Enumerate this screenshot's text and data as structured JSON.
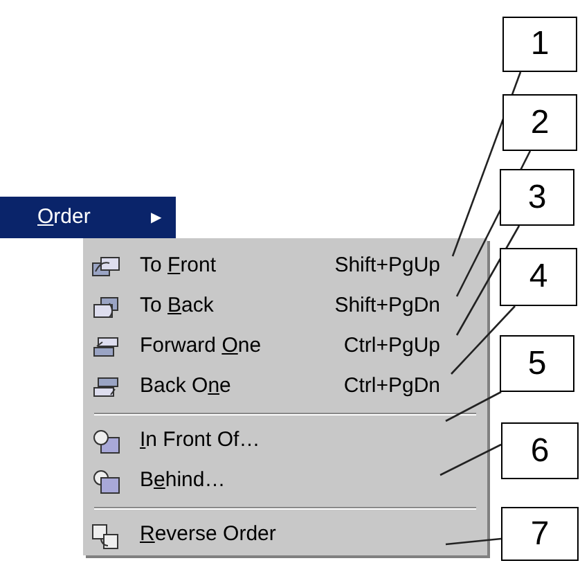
{
  "parent_item": {
    "label": {
      "key": "O",
      "post": "rder"
    },
    "arrow": "▶"
  },
  "menu": {
    "groups": [
      [
        {
          "kind": "front",
          "label": {
            "pre": "To ",
            "key": "F",
            "post": "ront"
          },
          "shortcut": "Shift+PgUp"
        },
        {
          "kind": "back",
          "label": {
            "pre": "To ",
            "key": "B",
            "post": "ack"
          },
          "shortcut": "Shift+PgDn"
        },
        {
          "kind": "forward",
          "label": {
            "pre": "Forward ",
            "key": "O",
            "post": "ne"
          },
          "shortcut": "Ctrl+PgUp"
        },
        {
          "kind": "backward",
          "label": {
            "pre": "Back O",
            "key": "n",
            "post": "e"
          },
          "shortcut": "Ctrl+PgDn"
        }
      ],
      [
        {
          "kind": "infront",
          "label": {
            "key": "I",
            "post": "n Front Of…"
          }
        },
        {
          "kind": "behind",
          "label": {
            "pre": "B",
            "key": "e",
            "post": "hind…"
          }
        }
      ],
      [
        {
          "kind": "reverse",
          "label": {
            "key": "R",
            "post": "everse Order"
          }
        }
      ]
    ]
  },
  "callouts": [
    {
      "number": "1"
    },
    {
      "number": "2"
    },
    {
      "number": "3"
    },
    {
      "number": "4"
    },
    {
      "number": "5"
    },
    {
      "number": "6"
    },
    {
      "number": "7"
    }
  ]
}
